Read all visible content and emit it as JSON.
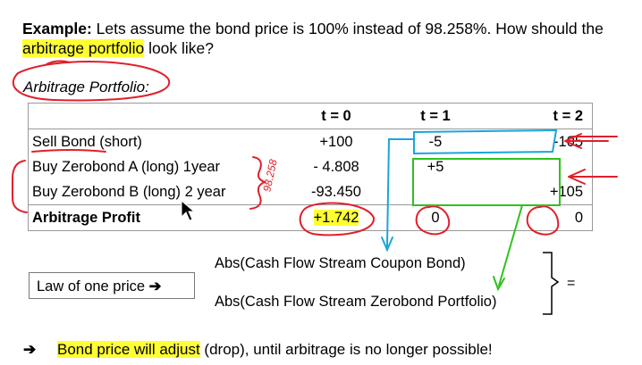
{
  "heading": {
    "bold": "Example:",
    "part1": " Lets assume the bond price is 100% instead of 98.258%. How should the ",
    "highlight": "arbitrage portfolio",
    "part2": " look like?"
  },
  "section_label": "Arbitrage Portfolio:",
  "table": {
    "headers": [
      "",
      "t = 0",
      "t = 1",
      "t = 2"
    ],
    "rows": [
      {
        "label": "Sell Bond",
        "suffix": " (short)",
        "t0": "+100",
        "t1": "-5",
        "t2": "-105"
      },
      {
        "label": "Buy Zerobond A (long) 1year",
        "suffix": "",
        "t0": "- 4.808",
        "t1": "+5",
        "t2": ""
      },
      {
        "label": "Buy Zerobond B (long) 2 year",
        "suffix": "",
        "t0": "-93.450",
        "t1": "",
        "t2": "+105"
      }
    ],
    "profit": {
      "label": "Arbitrage Profit",
      "t0": "+1.742",
      "t1": "0",
      "t2": "0"
    }
  },
  "law_box": {
    "label": "Law of one price",
    "arrow": "➔"
  },
  "abs_lines": {
    "line1": "Abs(Cash Flow Stream Coupon Bond)",
    "line2": "Abs(Cash Flow Stream Zerobond Portfolio)",
    "equals": "="
  },
  "conclusion": {
    "arrow": "➔",
    "highlight": "Bond price will adjust",
    "rest": " (drop), until arbitrage is no longer possible!"
  },
  "annotations": {
    "handwritten_note": "98.258"
  },
  "colors": {
    "highlight": "#ffff33",
    "ink_red": "#e0202a",
    "ink_blue": "#1aa6d9",
    "ink_green": "#2ec21e"
  }
}
